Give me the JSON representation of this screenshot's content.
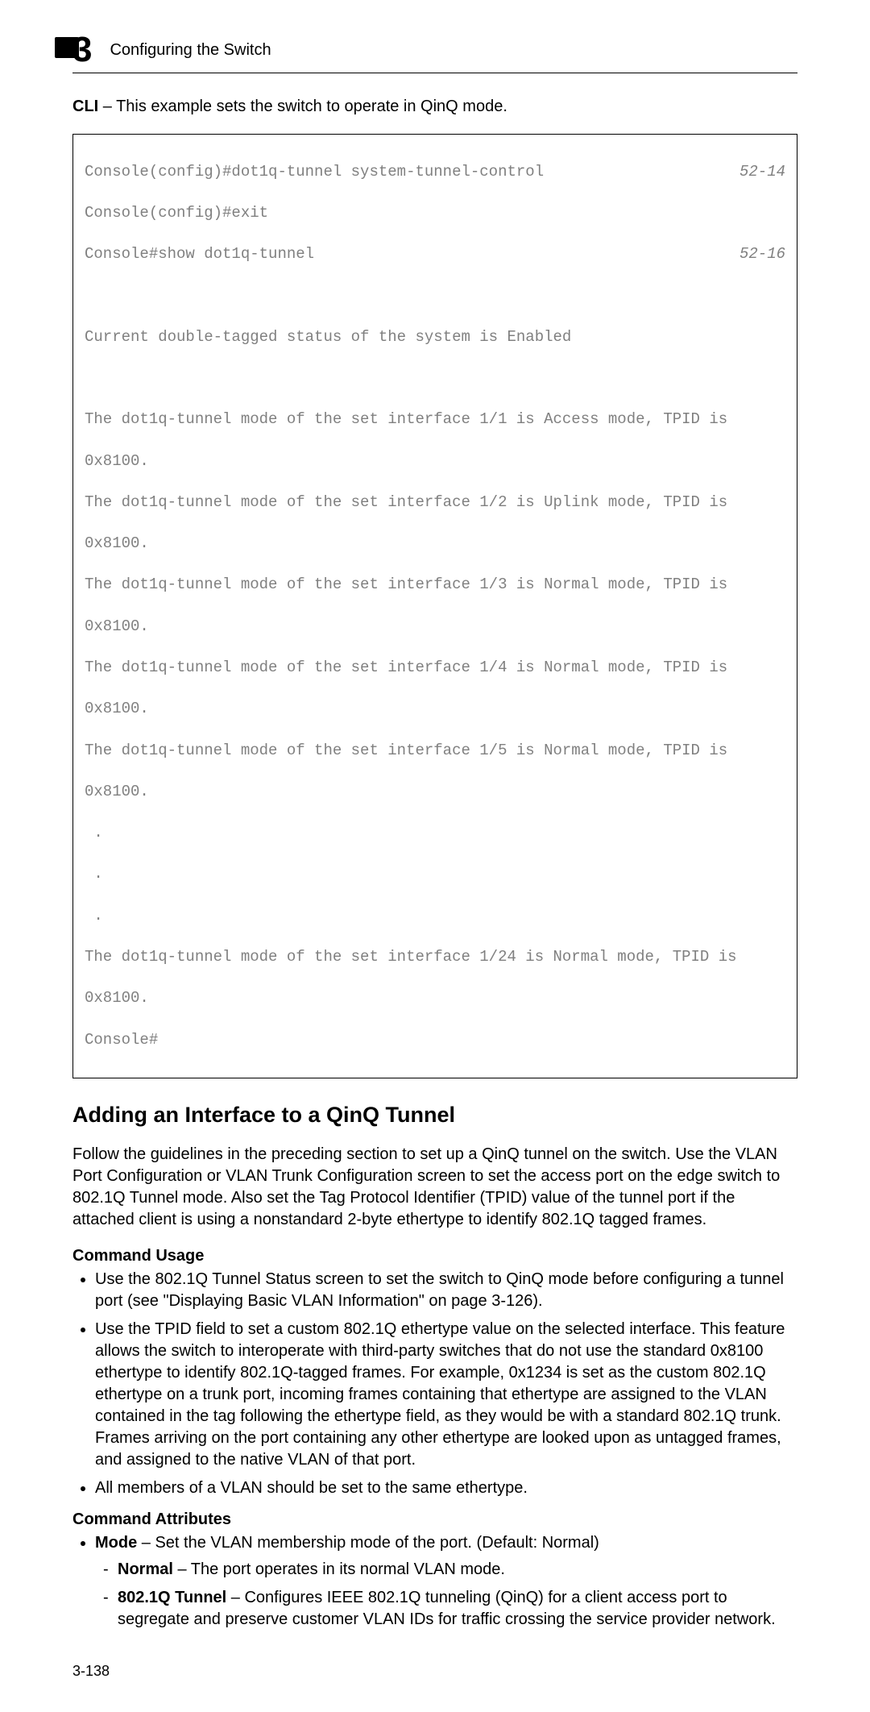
{
  "header": {
    "chapter_number": "3",
    "title": "Configuring the Switch"
  },
  "intro": {
    "cli_label": "CLI",
    "intro_text": " – This example sets the switch to operate in QinQ mode."
  },
  "cli": {
    "line1_left": "Console(config)#dot1q-tunnel system-tunnel-control",
    "line1_right": "52-14",
    "line2": "Console(config)#exit",
    "line3_left": "Console#show dot1q-tunnel",
    "line3_right": "52-16",
    "status": "Current double-tagged status of the system is Enabled",
    "if1a": "The dot1q-tunnel mode of the set interface 1/1 is Access mode, TPID is",
    "if1b": "0x8100.",
    "if2a": "The dot1q-tunnel mode of the set interface 1/2 is Uplink mode, TPID is",
    "if2b": "0x8100.",
    "if3a": "The dot1q-tunnel mode of the set interface 1/3 is Normal mode, TPID is",
    "if3b": "0x8100.",
    "if4a": "The dot1q-tunnel mode of the set interface 1/4 is Normal mode, TPID is",
    "if4b": "0x8100.",
    "if5a": "The dot1q-tunnel mode of the set interface 1/5 is Normal mode, TPID is",
    "if5b": "0x8100.",
    "dots1": " .",
    "dots2": " .",
    "dots3": " .",
    "if24a": "The dot1q-tunnel mode of the set interface 1/24 is Normal mode, TPID is",
    "if24b": "0x8100.",
    "prompt": "Console#"
  },
  "section": {
    "heading": "Adding an Interface to a QinQ Tunnel",
    "para": "Follow the guidelines in the preceding section to set up a QinQ tunnel on the switch. Use the VLAN Port Configuration or VLAN Trunk Configuration screen to set the access port on the edge switch to 802.1Q Tunnel mode. Also set the Tag Protocol Identifier (TPID) value of the tunnel port if the attached client is using a nonstandard 2-byte ethertype to identify 802.1Q tagged frames."
  },
  "usage": {
    "heading": "Command Usage",
    "b1": "Use the 802.1Q Tunnel Status screen to set the switch to QinQ mode before configuring a tunnel port (see \"Displaying Basic VLAN Information\" on page 3-126).",
    "b2": "Use the TPID field to set a custom 802.1Q ethertype value on the selected interface. This feature allows the switch to interoperate with third-party switches that do not use the standard 0x8100 ethertype to identify 802.1Q-tagged frames. For example, 0x1234 is set as the custom 802.1Q ethertype on a trunk port, incoming frames containing that ethertype are assigned to the VLAN contained in the tag following the ethertype field, as they would be with a standard 802.1Q trunk. Frames arriving on the port containing any other ethertype are looked upon as untagged frames, and assigned to the native VLAN of that port.",
    "b3": "All members of a VLAN should be set to the same ethertype."
  },
  "attributes": {
    "heading": "Command Attributes",
    "mode_label": "Mode",
    "mode_text": " – Set the VLAN membership mode of the port. (Default: Normal)",
    "normal_label": "Normal",
    "normal_text": " – The port operates in its normal VLAN mode.",
    "tunnel_label": "802.1Q Tunnel",
    "tunnel_text": " – Configures IEEE 802.1Q tunneling (QinQ) for a client access port to segregate and preserve customer VLAN IDs for traffic crossing the service provider network."
  },
  "footer": {
    "page_number": "3-138"
  }
}
